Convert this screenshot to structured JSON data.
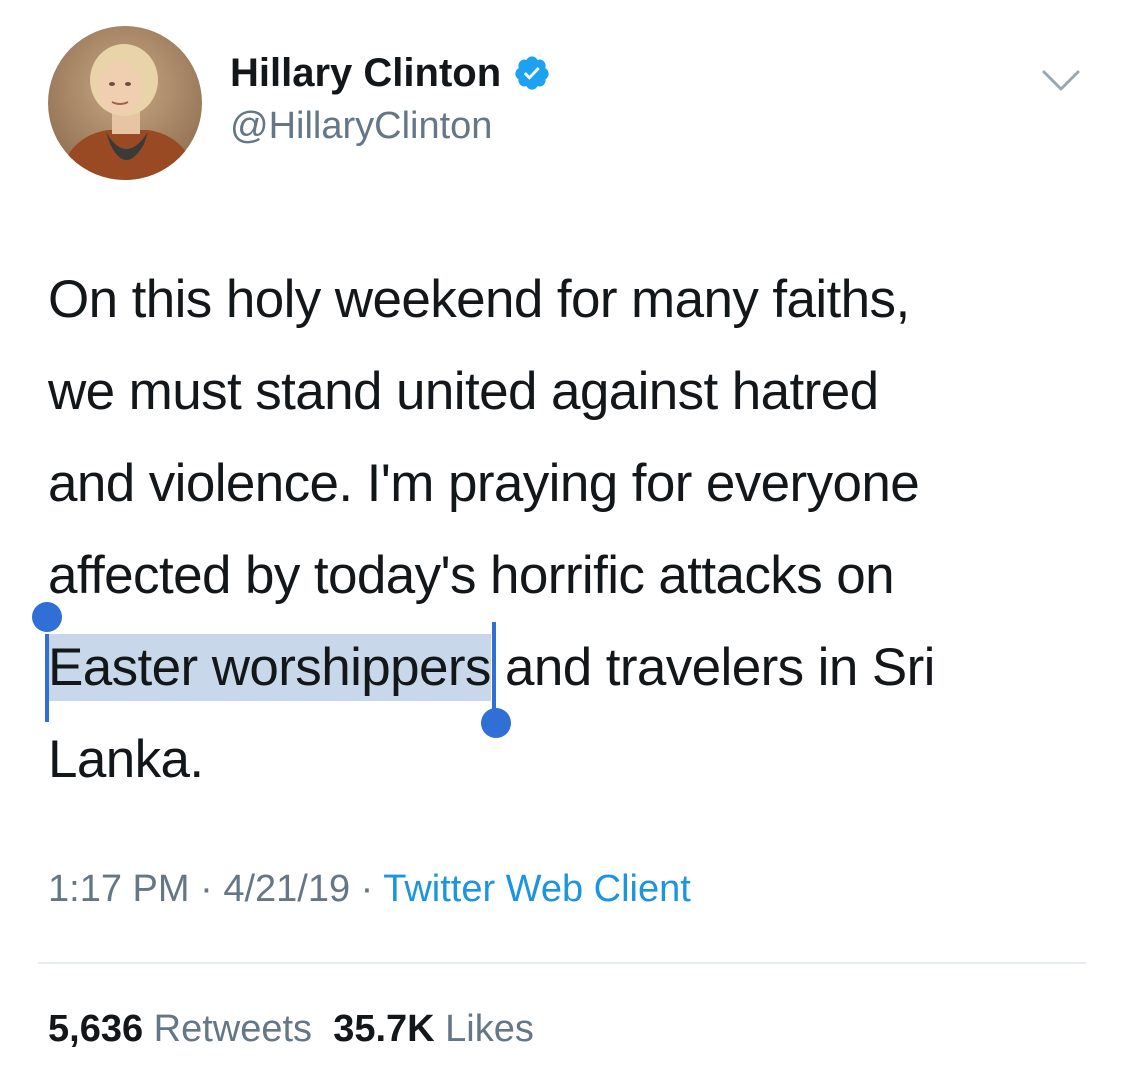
{
  "header": {
    "display_name": "Hillary Clinton",
    "handle": "@HillaryClinton",
    "verified": true,
    "avatar_icon": "profile-photo",
    "menu_icon": "chevron-down-icon"
  },
  "tweet": {
    "lines": [
      "On this holy weekend for many faiths,",
      "we must stand united against hatred",
      "and violence. I'm praying for everyone",
      "affected by today's horrific attacks on"
    ],
    "selected_text": "Easter worshippers",
    "line5_rest": " and travelers in Sri",
    "last_line": "Lanka."
  },
  "meta": {
    "time": "1:17 PM",
    "separator": " · ",
    "date": "4/21/19",
    "source": "Twitter Web Client"
  },
  "stats": {
    "retweets_count": "5,636",
    "retweets_label": "Retweets",
    "likes_count": "35.7K",
    "likes_label": "Likes"
  },
  "colors": {
    "text": "#14171a",
    "secondary": "#657786",
    "link": "#1b95e0",
    "selection": "#c8d8ea",
    "selection_handle": "#2f6fd6",
    "verified": "#1da1f2"
  }
}
